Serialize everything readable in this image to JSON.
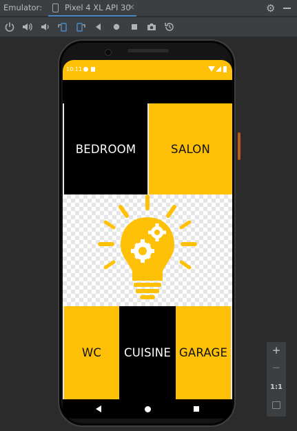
{
  "titlebar": {
    "label": "Emulator:",
    "tab_name": "Pixel 4 XL API 30",
    "close_glyph": "×"
  },
  "toolbar": {
    "icons": [
      "power-icon",
      "volume-up-icon",
      "volume-down-icon",
      "rotate-left-icon",
      "rotate-right-icon",
      "back-icon",
      "home-icon",
      "overview-icon",
      "camera-icon",
      "snapshot-icon"
    ]
  },
  "device": {
    "status_time": "10:11"
  },
  "app": {
    "tiles": {
      "bedroom": "BEDROOM",
      "salon": "SALON",
      "wc": "WC",
      "cuisine": "CUISINE",
      "garage": "GARAGE"
    },
    "colors": {
      "accent": "#ffc107",
      "dark": "#000000"
    }
  },
  "zoom_controls": {
    "plus": "+",
    "minus": "−",
    "ratio": "1:1"
  }
}
